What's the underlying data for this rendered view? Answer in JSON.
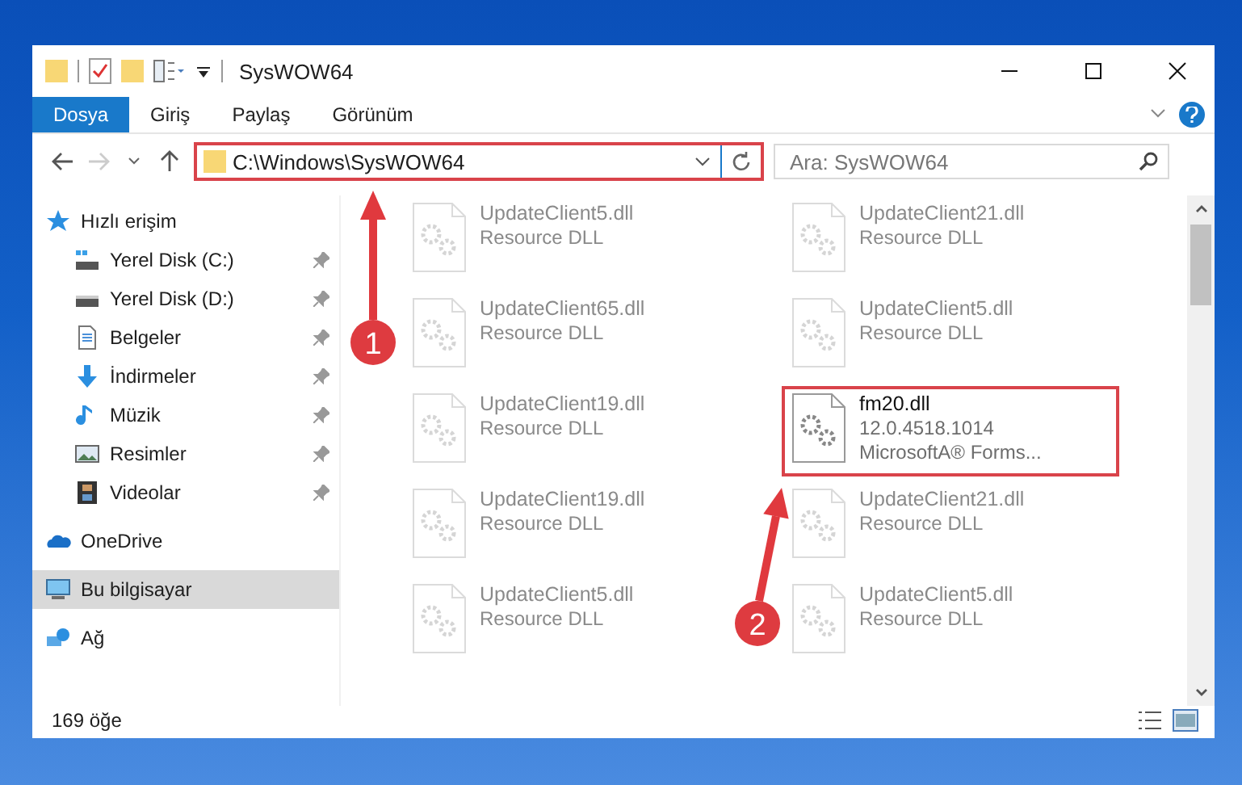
{
  "window": {
    "title": "SysWOW64"
  },
  "ribbon_tabs": [
    {
      "label": "Dosya",
      "kind": "file",
      "selected": false
    },
    {
      "label": "Giriş",
      "kind": "tab",
      "selected": false
    },
    {
      "label": "Paylaş",
      "kind": "tab",
      "selected": false
    },
    {
      "label": "Görünüm",
      "kind": "tab",
      "selected": false
    }
  ],
  "address": {
    "value": "C:\\Windows\\SysWOW64",
    "highlighted": true
  },
  "search": {
    "placeholder": "Ara: SysWOW64"
  },
  "sidebar": {
    "items": [
      {
        "label": "Hızlı erişim",
        "selected": false,
        "children": [
          {
            "label": "Yerel Disk (C:)",
            "pinned": true,
            "selected": false
          },
          {
            "label": "Yerel Disk (D:)",
            "pinned": true,
            "selected": false
          },
          {
            "label": "Belgeler",
            "pinned": true,
            "selected": false
          },
          {
            "label": "İndirmeler",
            "pinned": true,
            "selected": false
          },
          {
            "label": "Müzik",
            "pinned": true,
            "selected": false
          },
          {
            "label": "Resimler",
            "pinned": true,
            "selected": false
          },
          {
            "label": "Videolar",
            "pinned": true,
            "selected": false
          }
        ]
      },
      {
        "label": "OneDrive",
        "selected": false
      },
      {
        "label": "Bu bilgisayar",
        "selected": true
      },
      {
        "label": "Ağ",
        "selected": false
      }
    ]
  },
  "files": [
    {
      "name": "UpdateClient5.dll",
      "lines": [
        "Resource DLL"
      ],
      "faded": true,
      "highlighted": false
    },
    {
      "name": "UpdateClient21.dll",
      "lines": [
        "Resource DLL"
      ],
      "faded": true,
      "highlighted": false
    },
    {
      "name": "UpdateClient65.dll",
      "lines": [
        "Resource DLL"
      ],
      "faded": true,
      "highlighted": false
    },
    {
      "name": "UpdateClient5.dll",
      "lines": [
        "Resource DLL"
      ],
      "faded": true,
      "highlighted": false
    },
    {
      "name": "UpdateClient19.dll",
      "lines": [
        "Resource DLL"
      ],
      "faded": true,
      "highlighted": false
    },
    {
      "name": "fm20.dll",
      "lines": [
        "12.0.4518.1014",
        "MicrosoftA® Forms..."
      ],
      "faded": false,
      "highlighted": true
    },
    {
      "name": "UpdateClient19.dll",
      "lines": [
        "Resource DLL"
      ],
      "faded": true,
      "highlighted": false
    },
    {
      "name": "UpdateClient21.dll",
      "lines": [
        "Resource DLL"
      ],
      "faded": true,
      "highlighted": false
    },
    {
      "name": "UpdateClient5.dll",
      "lines": [
        "Resource DLL"
      ],
      "faded": true,
      "highlighted": false
    },
    {
      "name": "UpdateClient5.dll",
      "lines": [
        "Resource DLL"
      ],
      "faded": true,
      "highlighted": false
    }
  ],
  "status_bar": {
    "count": "169 öğe"
  },
  "annotations": [
    {
      "number": "1"
    },
    {
      "number": "2"
    }
  ]
}
